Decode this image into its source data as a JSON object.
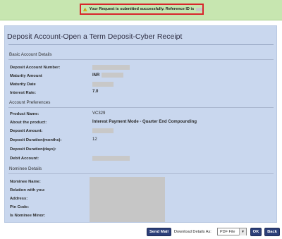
{
  "notice": {
    "text": "Your Request is submitted successfully. Reference ID is"
  },
  "page": {
    "title": "Deposit Account-Open a Term Deposit-Cyber Receipt"
  },
  "sections": {
    "basic": "Basic Account Details",
    "preferences": "Account Preferences",
    "nominee": "Nominee Details"
  },
  "basic": {
    "deposit_account_number_label": "Deposit Account Number:",
    "maturity_amount_label": "Maturity Amount",
    "maturity_amount_currency": "INR",
    "maturity_date_label": "Maturity Date",
    "interest_rate_label": "Interest Rate:",
    "interest_rate_value": "7.0"
  },
  "preferences": {
    "product_name_label": "Product Name:",
    "product_name_value": "VC329",
    "about_label": "About the product:",
    "about_value": "Interest Payment Mode - Quarter End Compounding",
    "deposit_amount_label": "Deposit Amount:",
    "duration_months_label": "Deposit Duration(months):",
    "duration_months_value": "12",
    "duration_days_label": "Deposit Duration(days):",
    "debit_account_label": "Debit Account:"
  },
  "nominee": {
    "name_label": "Nominee Name:",
    "relation_label": "Relation with you:",
    "address_label": "Address:",
    "pin_label": "Pin Code:",
    "minor_label": "Is Nominee Minor:"
  },
  "actions": {
    "send_mail": "Send Mail",
    "download_label": "Download Details As:",
    "download_format": "PDF File",
    "ok": "OK",
    "back": "Back"
  },
  "colors": {
    "success_bar": "#c7e6b0",
    "notice_border": "#d8262c",
    "panel_bg": "#c9d7ee",
    "button_bg": "#2c3f79"
  }
}
